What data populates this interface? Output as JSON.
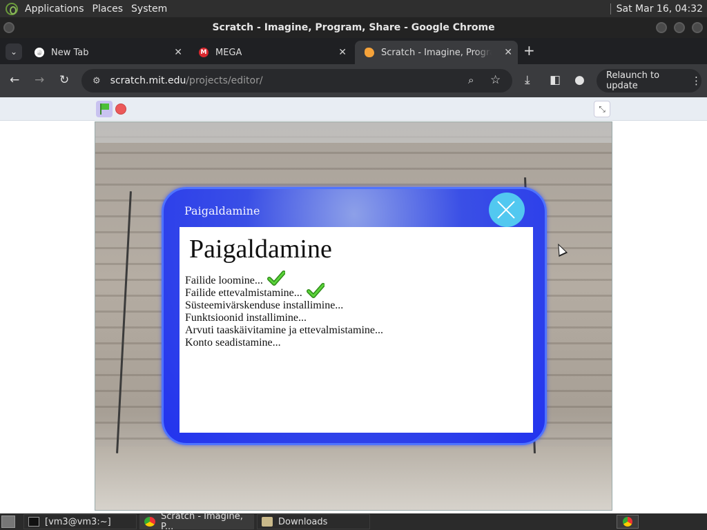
{
  "top_panel": {
    "menus": [
      "Applications",
      "Places",
      "System"
    ],
    "clock": "Sat Mar 16, 04:32"
  },
  "window": {
    "title": "Scratch - Imagine, Program, Share - Google Chrome"
  },
  "tabs": [
    {
      "label": "New Tab",
      "icon": "chrome-icon"
    },
    {
      "label": "MEGA",
      "icon": "mega-icon"
    },
    {
      "label": "Scratch - Imagine, Program, Share",
      "icon": "scratch-icon",
      "active": true
    }
  ],
  "toolbar": {
    "url_host": "scratch.mit.edu",
    "url_path": "/projects/editor/",
    "relaunch_label": "Relaunch to update"
  },
  "dialog": {
    "title": "Paigaldamine",
    "heading": "Paigaldamine",
    "steps": [
      {
        "text": "Failide loomine...",
        "done": true
      },
      {
        "text": "Failide ettevalmistamine...",
        "done": true
      },
      {
        "text": "Süsteemivärskenduse installimine...",
        "done": false
      },
      {
        "text": "Funktsioonid installimine...",
        "done": false
      },
      {
        "text": "Arvuti taaskäivitamine ja ettevalmistamine...",
        "done": false
      },
      {
        "text": "Konto seadistamine...",
        "done": false
      }
    ]
  },
  "taskbar": {
    "items": [
      {
        "label": "[vm3@vm3:~]",
        "icon": "terminal-icon"
      },
      {
        "label": "Scratch - Imagine, P...",
        "icon": "chrome-icon",
        "active": true
      },
      {
        "label": "Downloads",
        "icon": "folder-icon"
      }
    ]
  },
  "colors": {
    "dialog_blue": "#2233ee",
    "close_button": "#52c8f0",
    "check_green": "#4cc92a"
  }
}
